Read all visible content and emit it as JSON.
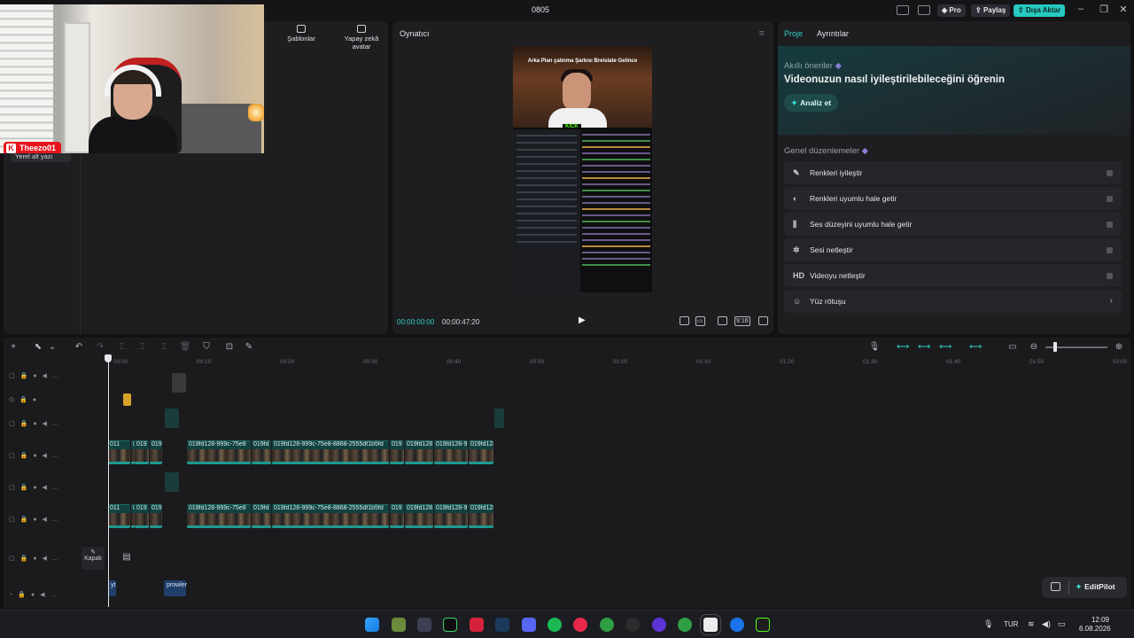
{
  "window": {
    "title": "0805"
  },
  "titlebar": {
    "pro_label": "Pro",
    "share_label": "Paylaş",
    "export_label": "Dışa Aktar",
    "minimize": "–",
    "maximize": "❐",
    "close": "✕"
  },
  "overlay": {
    "streamer_name": "Theezo01",
    "platform_letter": "K"
  },
  "media_panel": {
    "tabs": [
      {
        "label": "Şablonlar"
      },
      {
        "label": "Yapay zekâ avatar"
      }
    ],
    "caption_item": "Yerel alt yazı"
  },
  "player": {
    "title": "Oynatıcı",
    "menu_icon": "≡",
    "preview_caption": "Arka Plan çalınma Şarkısı Breislate Gelince",
    "preview_logo": "KICK",
    "current_time": "00:00:00:00",
    "total_time": "00:00:47:20",
    "ratio_label": "9:16",
    "play_glyph": "▶"
  },
  "right_panel": {
    "tabs": [
      {
        "label": "Proje",
        "active": true
      },
      {
        "label": "Ayrıntılar",
        "active": false
      }
    ],
    "ai_kicker": "Akıllı öneriler",
    "ai_headline": "Videonuzun nasıl iyileştirilebileceğini öğrenin",
    "analyze_label": "Analiz et",
    "general_title": "Genel düzenlemeler",
    "items": [
      {
        "label": "Renkleri iyileştir",
        "icon": "✎",
        "type": "toggle"
      },
      {
        "label": "Renkleri uyumlu hale getir",
        "icon": "◐",
        "type": "toggle"
      },
      {
        "label": "Ses düzeyini uyumlu hale getir",
        "icon": "⫼",
        "type": "toggle"
      },
      {
        "label": "Sesi netleştir",
        "icon": "✲",
        "type": "toggle"
      },
      {
        "label": "Videoyu netleştir",
        "icon": "HD",
        "type": "toggle"
      },
      {
        "label": "Yüz rötuşu",
        "icon": "☺",
        "type": "chevron"
      }
    ]
  },
  "timeline": {
    "ruler_ticks": [
      "00:00",
      "00:10",
      "00:20",
      "00:30",
      "00:40",
      "00:50",
      "01:00",
      "01:10",
      "01:20",
      "01:30",
      "01:40",
      "01:50",
      "02:00"
    ],
    "clip_labels": [
      "011",
      "0",
      "019",
      "019fd128-999c-75e8",
      "019fd",
      "019fd128-999c-75e8-8868-2555df1b5fd",
      "019",
      "019fd128",
      "019fd128-9",
      "019fd128"
    ],
    "cover_label": "Kapak",
    "text_clips": [
      "yt",
      "prowler"
    ],
    "editpilot_label": "EditPilot"
  },
  "taskbar": {
    "lang": "TUR",
    "time": "12:09",
    "date": "6.08.2026"
  }
}
